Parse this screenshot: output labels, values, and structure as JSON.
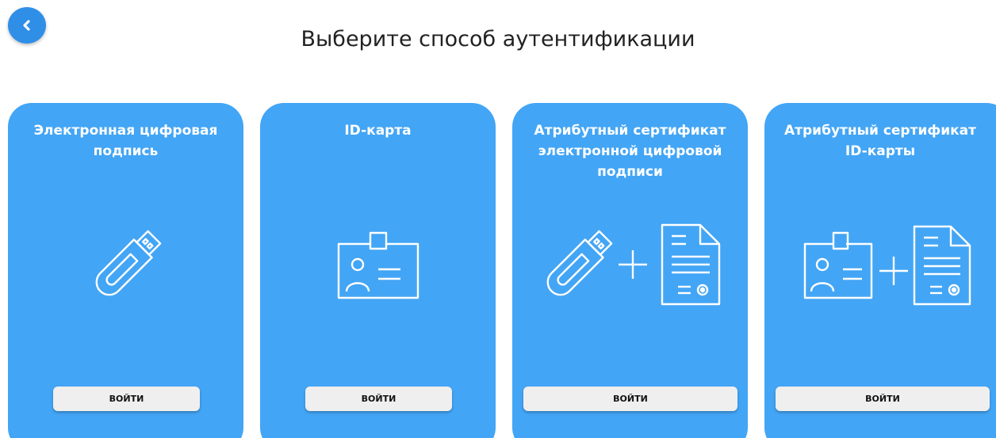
{
  "header": {
    "back_icon": "chevron-left-icon",
    "title": "Выберите способ аутентификации"
  },
  "cards": [
    {
      "title": "Электронная цифровая подпись",
      "icon": "usb-token-icon",
      "button_label": "ВОЙТИ"
    },
    {
      "title": "ID-карта",
      "icon": "id-card-icon",
      "button_label": "ВОЙТИ"
    },
    {
      "title": "Атрибутный сертификат электронной цифровой подписи",
      "icon": "usb-token-plus-certificate-icon",
      "button_label": "ВОЙТИ"
    },
    {
      "title": "Атрибутный сертификат ID-карты",
      "icon": "id-card-plus-certificate-icon",
      "button_label": "ВОЙТИ"
    }
  ],
  "colors": {
    "card_background": "#43a5f5",
    "back_button": "#2f8fe6",
    "button_background": "#efefef"
  }
}
